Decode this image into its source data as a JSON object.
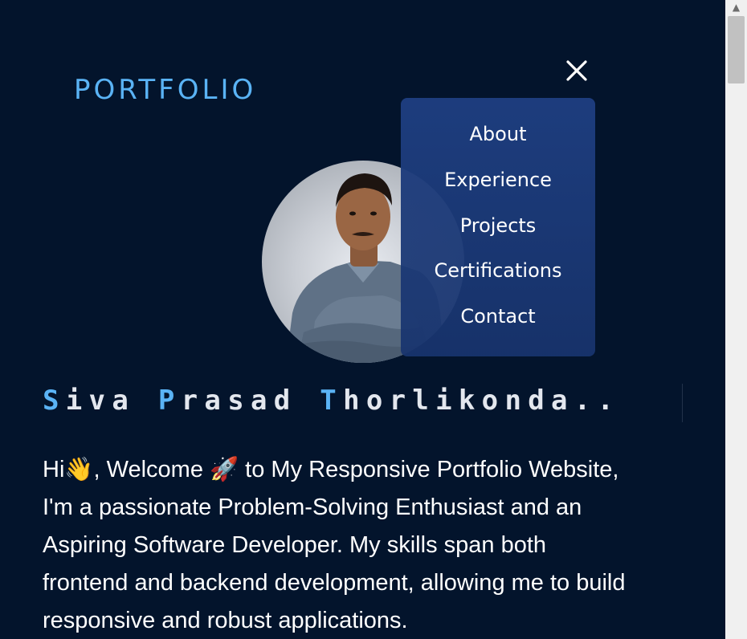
{
  "header": {
    "logo": "PORTFOLIO",
    "close_icon": "close-icon"
  },
  "nav": {
    "items": [
      "About",
      "Experience",
      "Projects",
      "Certifications",
      "Contact"
    ]
  },
  "profile": {
    "photo_icon": "profile-photo"
  },
  "hero": {
    "name_parts": [
      {
        "text": "S",
        "accent": true
      },
      {
        "text": "iva ",
        "accent": false
      },
      {
        "text": "P",
        "accent": true
      },
      {
        "text": "rasad ",
        "accent": false
      },
      {
        "text": "T",
        "accent": true
      },
      {
        "text": "horlikonda..",
        "accent": false
      }
    ],
    "intro_lines": [
      "Hi👋, Welcome 🚀 to My Responsive Portfolio Website,",
      "I'm a passionate Problem-Solving Enthusiast and an",
      "Aspiring Software Developer. My skills span both",
      "frontend and backend development, allowing me to build",
      "responsive and robust applications."
    ]
  },
  "colors": {
    "background": "#03142c",
    "accent": "#5ab3f5",
    "menu": "#1e3e80"
  }
}
